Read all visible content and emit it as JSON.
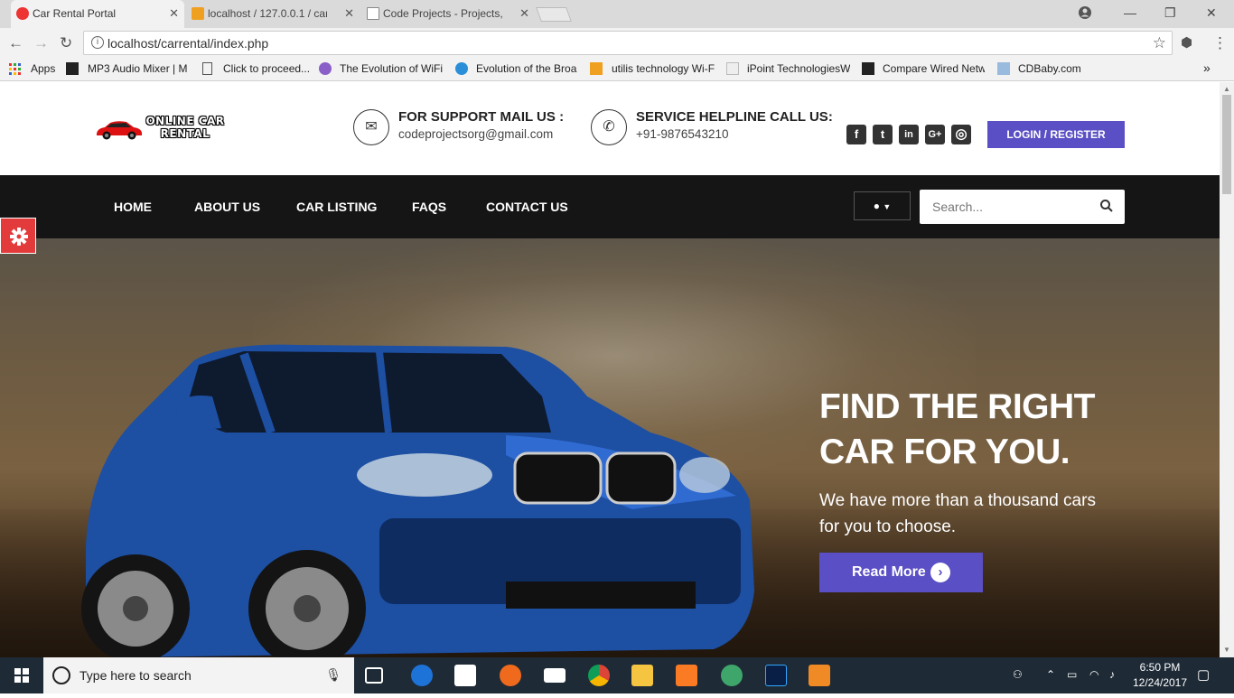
{
  "browser": {
    "tabs": [
      {
        "label": "Car Rental Portal",
        "active": true
      },
      {
        "label": "localhost / 127.0.0.1 / car",
        "active": false
      },
      {
        "label": "Code Projects - Projects,",
        "active": false
      }
    ],
    "url": "localhost/carrental/index.php",
    "bookmarks": [
      {
        "label": "Apps"
      },
      {
        "label": "MP3 Audio Mixer | M"
      },
      {
        "label": "Click to proceed..."
      },
      {
        "label": "The Evolution of WiFi"
      },
      {
        "label": "Evolution of the Broa"
      },
      {
        "label": "utilis technology Wi-F"
      },
      {
        "label": "iPoint TechnologiesW"
      },
      {
        "label": "Compare Wired Netw"
      },
      {
        "label": "CDBaby.com"
      }
    ],
    "overflow_label": "»"
  },
  "header": {
    "logo_line1": "ONLINE CAR",
    "logo_line2": "RENTAL",
    "support": {
      "title": "FOR SUPPORT MAIL US :",
      "value": "codeprojectsorg@gmail.com"
    },
    "helpline": {
      "title": "SERVICE HELPLINE CALL US:",
      "value": "+91-9876543210"
    },
    "social": {
      "facebook": "f",
      "twitter": "t",
      "linkedin": "in",
      "googleplus": "G+",
      "instagram": "◎"
    },
    "login_label": "LOGIN / REGISTER"
  },
  "nav": {
    "items": [
      "HOME",
      "ABOUT US",
      "CAR LISTING",
      "FAQS",
      "CONTACT US"
    ],
    "search_placeholder": "Search..."
  },
  "hero": {
    "headline_line1": "FIND THE RIGHT",
    "headline_line2": "CAR FOR YOU.",
    "subtitle": "We have more than a thousand cars for you to choose.",
    "button_label": "Read More"
  },
  "taskbar": {
    "search_placeholder": "Type here to search",
    "time": "6:50 PM",
    "date": "12/24/2017"
  },
  "colors": {
    "accent": "#5a4fc4",
    "navbar": "#151515",
    "gear": "#e33b3b"
  }
}
